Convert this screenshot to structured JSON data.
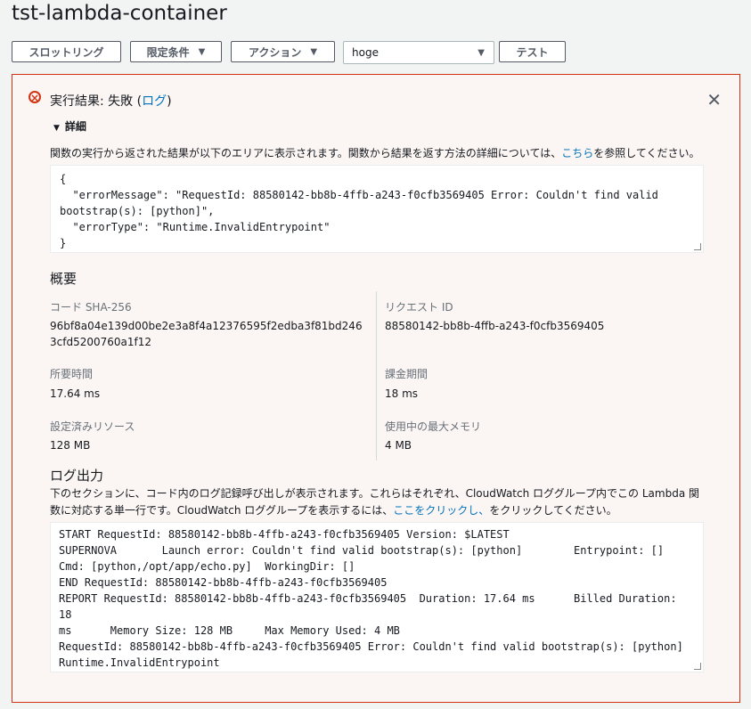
{
  "app": {
    "title": "tst-lambda-container"
  },
  "toolbar": {
    "throttle_label": "スロットリング",
    "qualifier_label": "限定条件",
    "actions_label": "アクション",
    "test_event_value": "hoge",
    "test_label": "テスト"
  },
  "result": {
    "heading_prefix": "実行結果: 失敗 (",
    "heading_link": "ログ",
    "heading_suffix": ")",
    "details_label": "詳細",
    "description_prefix": "関数の実行から返された結果が以下のエリアに表示されます。関数から結果を返す方法の詳細については、",
    "description_link": "こちら",
    "description_suffix": "を参照してください。",
    "output": "{\n  \"errorMessage\": \"RequestId: 88580142-bb8b-4ffb-a243-f0cfb3569405 Error: Couldn't find valid\nbootstrap(s): [python]\",\n  \"errorType\": \"Runtime.InvalidEntrypoint\"\n}"
  },
  "summary": {
    "title": "概要",
    "code_sha_label": "コード SHA-256",
    "code_sha_value": "96bf8a04e139d00be2e3a8f4a12376595f2edba3f81bd2463cfd5200760a1f12",
    "request_id_label": "リクエスト ID",
    "request_id_value": "88580142-bb8b-4ffb-a243-f0cfb3569405",
    "duration_label": "所要時間",
    "duration_value": "17.64 ms",
    "billed_label": "課金期間",
    "billed_value": "18 ms",
    "resources_label": "設定済みリソース",
    "resources_value": "128 MB",
    "max_memory_label": "使用中の最大メモリ",
    "max_memory_value": "4 MB"
  },
  "log": {
    "title": "ログ出力",
    "desc_prefix": "下のセクションに、コード内のログ記録呼び出しが表示されます。これらはそれぞれ、CloudWatch ロググループ内でこの Lambda 関数に対応する単一行です。CloudWatch ロググループを表示するには、",
    "desc_link": "ここをクリックし、",
    "desc_suffix": "をクリックしてください。",
    "output": "START RequestId: 88580142-bb8b-4ffb-a243-f0cfb3569405 Version: $LATEST\nSUPERNOVA       Launch error: Couldn't find valid bootstrap(s): [python]        Entrypoint: []\nCmd: [python,/opt/app/echo.py]  WorkingDir: []\nEND RequestId: 88580142-bb8b-4ffb-a243-f0cfb3569405\nREPORT RequestId: 88580142-bb8b-4ffb-a243-f0cfb3569405  Duration: 17.64 ms      Billed Duration: 18\nms      Memory Size: 128 MB     Max Memory Used: 4 MB\nRequestId: 88580142-bb8b-4ffb-a243-f0cfb3569405 Error: Couldn't find valid bootstrap(s): [python]\nRuntime.InvalidEntrypoint"
  },
  "icons": {
    "error": "error-circle-icon",
    "close": "close-icon",
    "caret": "caret-down-icon"
  },
  "colors": {
    "error": "#d13212",
    "link": "#0073bb"
  }
}
